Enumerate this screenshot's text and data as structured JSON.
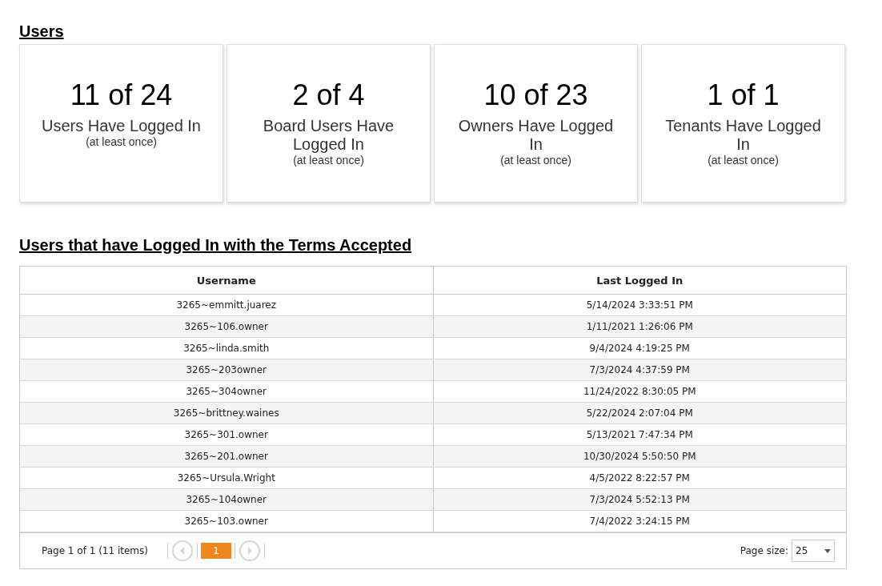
{
  "users_heading": "Users",
  "stats": [
    {
      "value": "11 of 24",
      "label": "Users Have Logged In",
      "note": "(at least once)"
    },
    {
      "value": "2 of 4",
      "label": "Board Users Have Logged In",
      "note": "(at least once)"
    },
    {
      "value": "10 of 23",
      "label": "Owners Have Logged In",
      "note": "(at least once)"
    },
    {
      "value": "1 of 1",
      "label": "Tenants Have Logged In",
      "note": "(at least once)"
    }
  ],
  "terms_heading": "Users that have Logged In with the Terms Accepted",
  "table": {
    "columns": [
      "Username",
      "Last Logged In"
    ],
    "rows": [
      [
        "3265~emmitt.juarez",
        "5/14/2024 3:33:51 PM"
      ],
      [
        "3265~106.owner",
        "1/11/2021 1:26:06 PM"
      ],
      [
        "3265~linda.smith",
        "9/4/2024 4:19:25 PM"
      ],
      [
        "3265~203owner",
        "7/3/2024 4:37:59 PM"
      ],
      [
        "3265~304owner",
        "11/24/2022 8:30:05 PM"
      ],
      [
        "3265~brittney.waines",
        "5/22/2024 2:07:04 PM"
      ],
      [
        "3265~301.owner",
        "5/13/2021 7:47:34 PM"
      ],
      [
        "3265~201.owner",
        "10/30/2024 5:50:50 PM"
      ],
      [
        "3265~Ursula.Wright",
        "4/5/2022 8:22:57 PM"
      ],
      [
        "3265~104owner",
        "7/3/2024 5:52:13 PM"
      ],
      [
        "3265~103.owner",
        "7/4/2022 3:24:15 PM"
      ]
    ]
  },
  "pager": {
    "summary": "Page 1 of 1 (11 items)",
    "prev_disabled": true,
    "next_disabled": true,
    "pages": [
      {
        "label": "1",
        "selected": true
      }
    ],
    "page_size_label": "Page size:",
    "page_size": "25"
  }
}
